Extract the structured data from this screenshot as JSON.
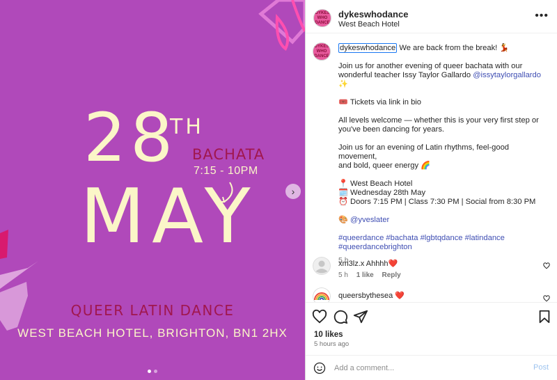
{
  "media": {
    "poster": {
      "day": "28",
      "day_suffix": "TH",
      "month": "MAY",
      "genre": "BACHATA",
      "time": "7:15 - 10PM",
      "event": "QUEER LATIN DANCE",
      "venue": "WEST BEACH HOTEL, BRIGHTON, BN1 2HX"
    },
    "background_color": "#b049ba",
    "carousel_dots": 2,
    "active_dot": 0
  },
  "post_header": {
    "username": "dykeswhodance",
    "location": "West Beach Hotel",
    "avatar_text": "DYKES WHO DANCE",
    "more_icon": "more-horizontal-icon"
  },
  "caption": {
    "username": "dykeswhodance",
    "first_line": "We are back from the break! 💃",
    "para1_line1": "Join us for another evening of queer bachata with our",
    "para1_line2_text": "wonderful teacher Issy Taylor Gallardo",
    "para1_mention": "@issytaylorgallardo",
    "para1_emoji": "✨",
    "tickets": "🎟️ Tickets via link in bio",
    "para3_line1": "All levels welcome — whether this is your very first step or",
    "para3_line2": "you've been dancing for years.",
    "para4_line1": "Join us for an evening of Latin rhythms, feel-good movement,",
    "para4_line2": "and bold, queer energy 🌈",
    "details_venue": "📍 West Beach Hotel",
    "details_date": "🗓️ Wednesday 28th May",
    "details_times": "⏰ Doors 7:15 PM | Class 7:30 PM | Social from 8:30 PM",
    "credit_emoji": "🎨",
    "credit_mention": "@yveslater",
    "hashtags_line1": "#queerdance #bachata #lgbtqdance #latindance",
    "hashtags_line2": "#queerdancebrighton",
    "time": "5 h"
  },
  "comments": [
    {
      "username": "xm3lz.x",
      "text": "Ahhhh❤️",
      "time": "5 h",
      "likes": "1 like",
      "reply": "Reply"
    },
    {
      "username": "queersbythesea",
      "text": "❤️"
    }
  ],
  "actions": {
    "likes": "10 likes",
    "time_ago": "5 hours ago",
    "comment_placeholder": "Add a comment...",
    "post_label": "Post"
  },
  "colors": {
    "accent_link": "#3f4eb3",
    "post_button": "#9dc3ef",
    "poster_cream": "#fbf6c8",
    "poster_magenta": "#a0174e"
  }
}
